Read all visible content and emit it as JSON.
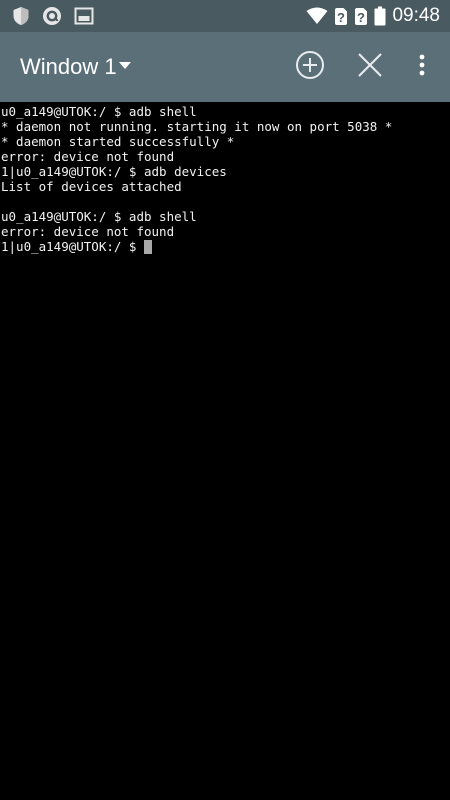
{
  "status_bar": {
    "left_icons": [
      "shield-icon",
      "at-sign-icon",
      "screen-icon"
    ],
    "right_icons": [
      "wifi-icon",
      "sim1-unknown-icon",
      "sim2-unknown-icon",
      "battery-icon"
    ],
    "time": "09:48",
    "bar_color": "#4a5a61"
  },
  "toolbar": {
    "window_title": "Window 1",
    "icons": [
      "add-window-icon",
      "close-window-icon",
      "more-vert-icon"
    ],
    "bar_color": "#5b6f78"
  },
  "terminal": {
    "lines": [
      "u0_a149@UTOK:/ $ adb shell",
      "* daemon not running. starting it now on port 5038 *",
      "* daemon started successfully *",
      "error: device not found",
      "1|u0_a149@UTOK:/ $ adb devices",
      "List of devices attached",
      "",
      "u0_a149@UTOK:/ $ adb shell",
      "error: device not found"
    ],
    "prompt": "1|u0_a149@UTOK:/ $ ",
    "text_color": "#f2f2f2",
    "background": "#000000"
  }
}
